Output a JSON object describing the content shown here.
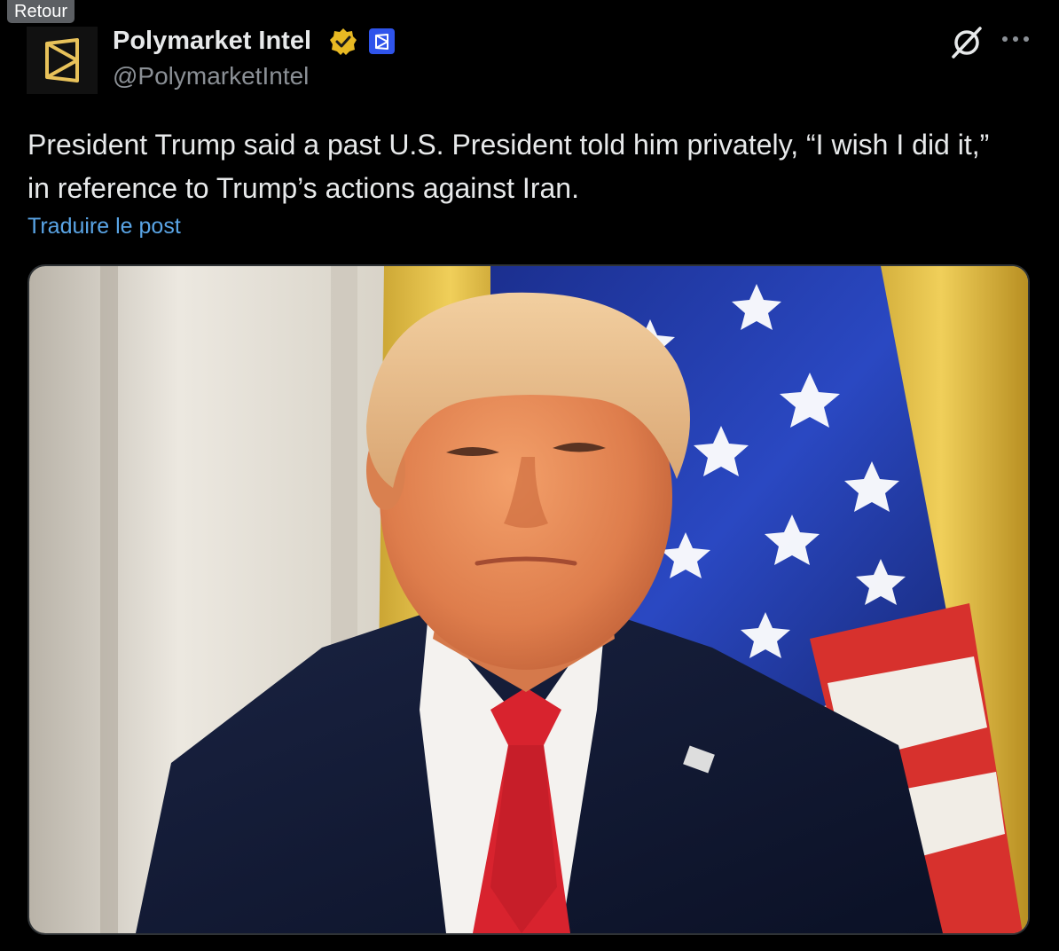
{
  "tooltip": {
    "label": "Retour"
  },
  "author": {
    "display_name": "Polymarket Intel",
    "handle": "@PolymarketIntel",
    "verified_color": "#e8b923",
    "affiliate_color": "#2f54eb"
  },
  "post": {
    "text": "President Trump said a past U.S. President told him privately, “I wish I did it,” in reference to Trump’s actions against Iran.",
    "translate_label": "Traduire le post"
  },
  "icons": {
    "grok": "grok-icon",
    "more": "more-options-icon"
  },
  "colors": {
    "background": "#000000",
    "text": "#e7e9ea",
    "muted": "#8b9096",
    "link": "#5aa5e6"
  }
}
